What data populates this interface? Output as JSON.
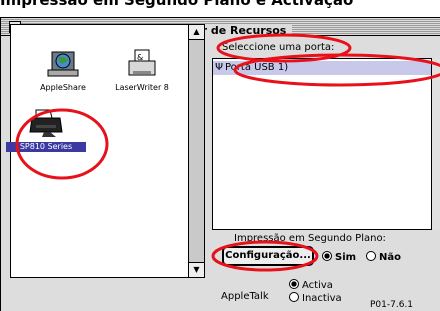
{
  "heading": "Impressão em Segundo Plano e Activação",
  "window": {
    "title": "Selector de Recursos"
  },
  "drivers": [
    {
      "label": "AppleShare",
      "icon": "appleshare-icon",
      "selected": false
    },
    {
      "label": "LaserWriter 8",
      "icon": "laserwriter-icon",
      "selected": false
    },
    {
      "label": "SP810 Series",
      "icon": "inkjet-printer-icon",
      "selected": true
    }
  ],
  "port": {
    "prompt": "Seleccione uma porta:",
    "items": [
      {
        "label": "Porta USB 1)",
        "icon": "usb-icon",
        "selected": true
      }
    ]
  },
  "background_printing": {
    "label": "Impressão em Segundo Plano:",
    "setup_button": "Configuração...",
    "options": [
      {
        "label": "Sim",
        "checked": true
      },
      {
        "label": "Não",
        "checked": false
      }
    ]
  },
  "appletalk": {
    "label": "AppleTalk",
    "options": [
      {
        "label": "Activa",
        "checked": true
      },
      {
        "label": "Inactiva",
        "checked": false
      }
    ]
  },
  "version": "P01-7.6.1",
  "colors": {
    "annotation": "#e8111a",
    "selection": "#3a3aa0",
    "list_highlight": "#c8c8ea"
  }
}
